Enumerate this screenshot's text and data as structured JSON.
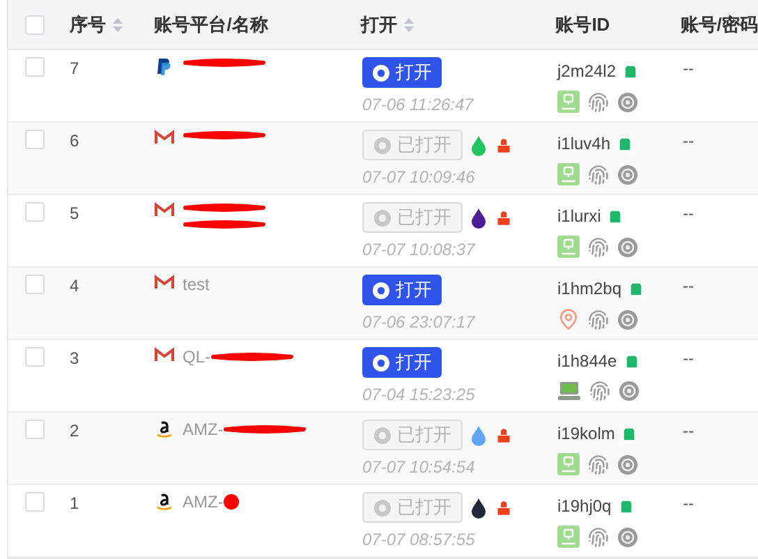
{
  "table": {
    "select_all": {
      "checked": false
    },
    "columns": [
      {
        "label": "序号",
        "sortable": true
      },
      {
        "label": "账号平台/名称",
        "sortable": false
      },
      {
        "label": "打开",
        "sortable": true
      },
      {
        "label": "账号ID",
        "sortable": false
      },
      {
        "label": "账号/密码",
        "sortable": false
      }
    ],
    "rows": [
      {
        "checked": false,
        "number": "7",
        "platform": {
          "kind": "paypal"
        },
        "name": "",
        "redaction": {
          "kind": "bar"
        },
        "open": {
          "kind": "open",
          "label": "打开"
        },
        "time": "07-06 11:26:47",
        "id": "j2m24l2",
        "network": {
          "kind": "proxy"
        },
        "password": "--"
      },
      {
        "checked": false,
        "number": "6",
        "platform": {
          "kind": "gmail"
        },
        "name": "",
        "redaction": {
          "kind": "bar"
        },
        "open": {
          "kind": "opened",
          "label": "已打开",
          "color": "#22c55e"
        },
        "time": "07-07 10:09:46",
        "id": "i1luv4h",
        "network": {
          "kind": "proxy"
        },
        "password": "--"
      },
      {
        "checked": false,
        "number": "5",
        "platform": {
          "kind": "gmail"
        },
        "name": "",
        "redaction": {
          "kind": "double"
        },
        "open": {
          "kind": "opened",
          "label": "已打开",
          "color": "#4c1d95"
        },
        "time": "07-07 10:08:37",
        "id": "i1lurxi",
        "network": {
          "kind": "proxy"
        },
        "password": "--"
      },
      {
        "checked": false,
        "number": "4",
        "platform": {
          "kind": "gmail"
        },
        "name": "test",
        "open": {
          "kind": "open",
          "label": "打开"
        },
        "time": "07-06 23:07:17",
        "id": "i1hm2bq",
        "network": {
          "kind": "location"
        },
        "password": "--"
      },
      {
        "checked": false,
        "number": "3",
        "platform": {
          "kind": "gmail"
        },
        "name": "QL-",
        "redaction": {
          "kind": "bar"
        },
        "open": {
          "kind": "open",
          "label": "打开"
        },
        "time": "07-04 15:23:25",
        "id": "i1h844e",
        "network": {
          "kind": "computer"
        },
        "password": "--"
      },
      {
        "checked": false,
        "number": "2",
        "platform": {
          "kind": "amazon"
        },
        "name": "AMZ-",
        "redaction": {
          "kind": "bar"
        },
        "open": {
          "kind": "opened",
          "label": "已打开",
          "color": "#60a5fa"
        },
        "time": "07-07 10:54:54",
        "id": "i19kolm",
        "network": {
          "kind": "proxy"
        },
        "password": "--"
      },
      {
        "checked": false,
        "number": "1",
        "platform": {
          "kind": "amazon"
        },
        "name": "AMZ-",
        "redaction": {
          "kind": "blob"
        },
        "open": {
          "kind": "opened",
          "label": "已打开",
          "color": "#1e293b"
        },
        "time": "07-07 08:57:55",
        "id": "i19hj0q",
        "network": {
          "kind": "proxy"
        },
        "password": "--"
      }
    ]
  }
}
